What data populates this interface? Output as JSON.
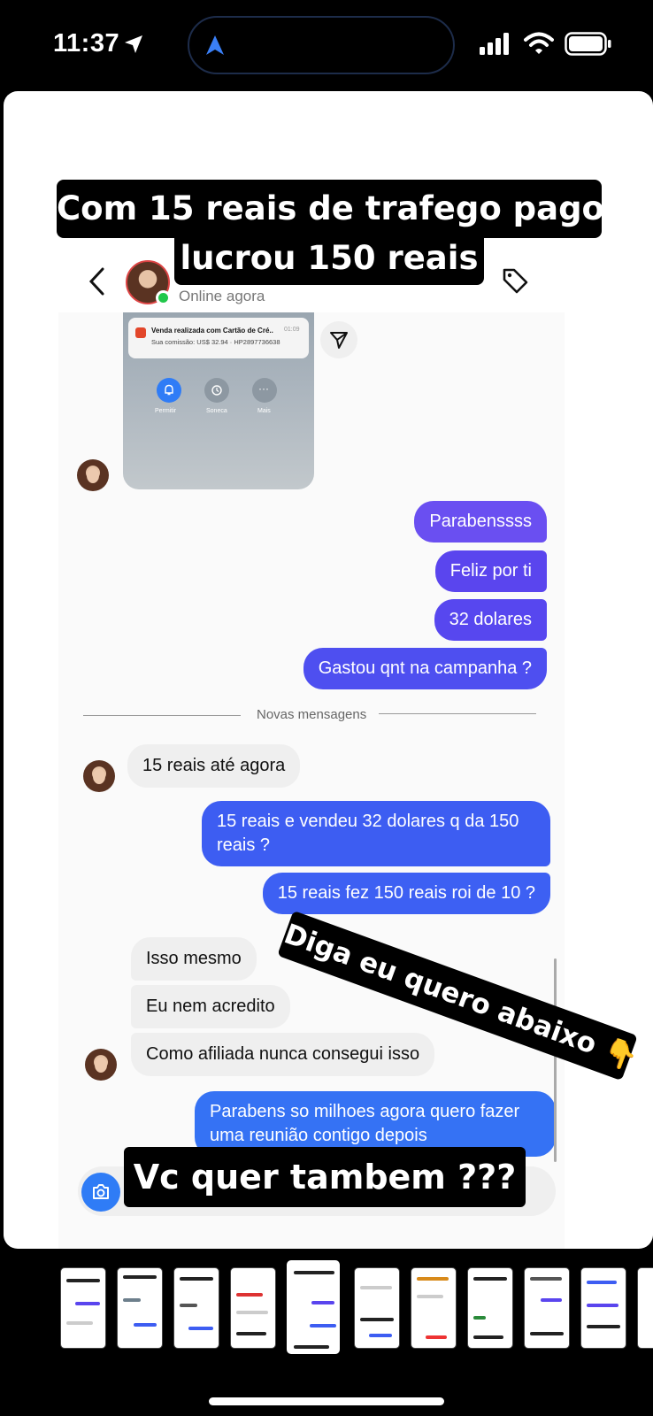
{
  "status_bar": {
    "time": "11:37"
  },
  "captions": {
    "top_line1": "Com 15 reais de trafego pago,",
    "top_line2": "lucrou 150 reais",
    "rotated": "Diga eu quero abaixo 👇",
    "bottom": "Vc quer tambem ???"
  },
  "chat": {
    "header_status": "Online agora",
    "notification": {
      "title": "Venda realizada com Cartão de Cré..",
      "time": "01:09",
      "body": "Sua comissão: US$ 32.94 · HP2897736638",
      "actions": [
        "Permitir",
        "Soneca",
        "Mais"
      ]
    },
    "divider_label": "Novas mensagens",
    "sent_first": [
      "Parabenssss",
      "Feliz por ti",
      "32 dolares",
      "Gastou qnt na campanha ?"
    ],
    "received_first": "15 reais até agora",
    "sent_second": [
      "15 reais e vendeu 32 dolares q da 150 reais ?",
      "15 reais fez 150 reais roi de 10 ?"
    ],
    "received_second": [
      "Isso mesmo",
      "Eu nem acredito",
      "Como afiliada nunca consegui isso"
    ],
    "sent_third": "Parabens so milhoes agora quero fazer uma reunião contigo depois"
  },
  "colors": {
    "purple": "#6a4ff1",
    "violet": "#5a45ee",
    "blue": "#3d5df2",
    "blue_bright": "#3572f4",
    "online": "#21c74a"
  }
}
